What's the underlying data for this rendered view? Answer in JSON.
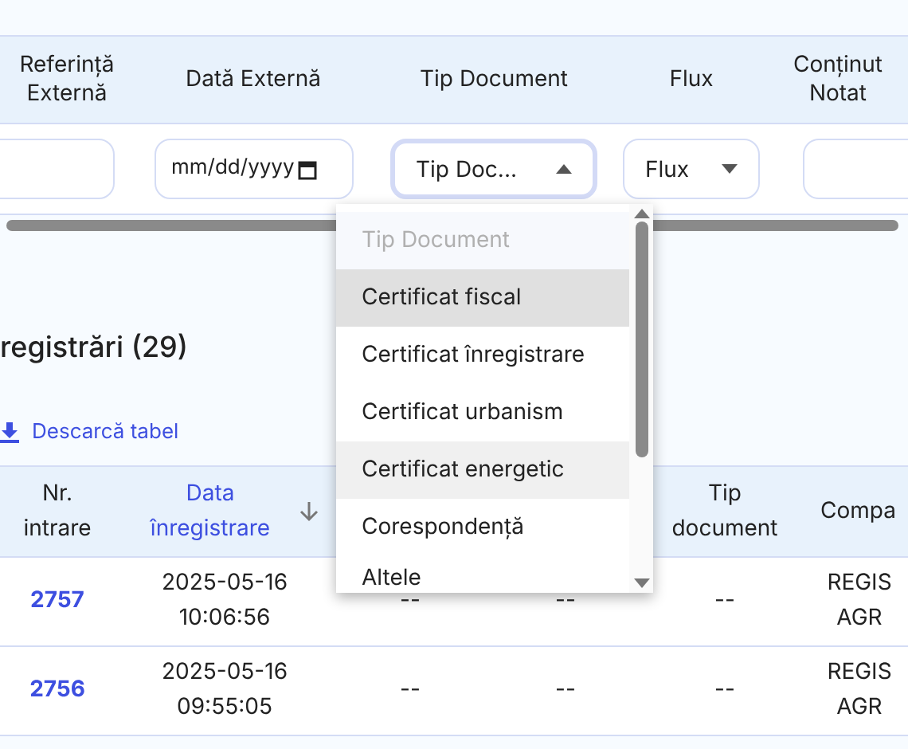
{
  "filter_table": {
    "columns": [
      {
        "label": "Referință Externă"
      },
      {
        "label": "Dată Externă"
      },
      {
        "label": "Tip Document"
      },
      {
        "label": "Flux"
      },
      {
        "label": "Conținut Notat"
      }
    ],
    "filters": [
      {
        "kind": "text"
      },
      {
        "kind": "date",
        "placeholder": "mm/dd/yyyy"
      },
      {
        "kind": "select",
        "value": "Tip Doc...",
        "expanded": true
      },
      {
        "kind": "select",
        "value": "Flux",
        "expanded": false
      },
      {
        "kind": "text"
      }
    ]
  },
  "dropdown": {
    "options": [
      {
        "kind": "placeholder",
        "label": "Tip Document",
        "selected": false,
        "hovered": false
      },
      {
        "kind": "option",
        "label": "Certificat fiscal",
        "selected": true,
        "hovered": false
      },
      {
        "kind": "option",
        "label": "Certificat înregistrare",
        "selected": false,
        "hovered": false
      },
      {
        "kind": "option",
        "label": "Certificat urbanism",
        "selected": false,
        "hovered": false
      },
      {
        "kind": "option",
        "label": "Certificat energetic",
        "selected": false,
        "hovered": true
      },
      {
        "kind": "option",
        "label": "Corespondență",
        "selected": false,
        "hovered": false
      },
      {
        "kind": "option",
        "label": "Altele",
        "selected": false,
        "hovered": false
      }
    ]
  },
  "section": {
    "title": "registrări (29)",
    "download_link": "Descarcă tabel"
  },
  "table": {
    "columns": [
      {
        "label": "Nr. intrare",
        "sorted": false
      },
      {
        "label": "Data înregistrare",
        "sorted": true
      },
      null,
      null,
      {
        "label": "Tip document",
        "sorted": false
      },
      {
        "label": "Compa",
        "sorted": false
      }
    ],
    "rows": [
      {
        "cells": [
          "2757",
          "2025-05-16 10:06:56",
          "--",
          "--",
          "--",
          "REGIS AGR"
        ]
      },
      {
        "cells": [
          "2756",
          "2025-05-16 09:55:05",
          "--",
          "--",
          "--",
          "REGIS AGR"
        ]
      }
    ]
  }
}
